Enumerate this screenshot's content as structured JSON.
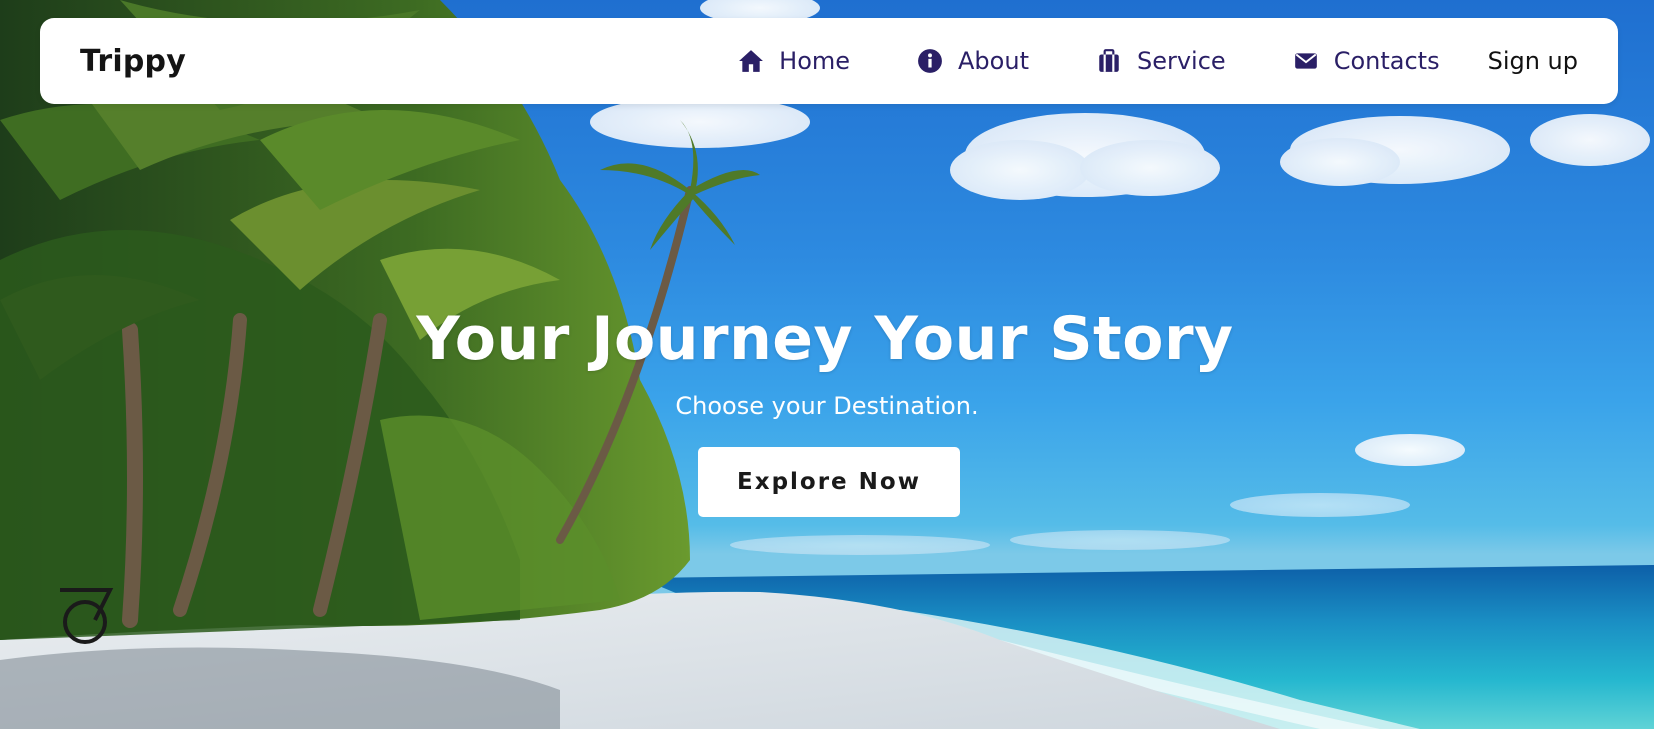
{
  "brand": {
    "name": "Trippy"
  },
  "nav": {
    "items": [
      {
        "label": "Home",
        "icon": "home-icon"
      },
      {
        "label": "About",
        "icon": "info-icon"
      },
      {
        "label": "Service",
        "icon": "suitcase-icon"
      },
      {
        "label": "Contacts",
        "icon": "envelope-icon"
      }
    ],
    "signup_label": "Sign up"
  },
  "hero": {
    "title": "Your Journey Your Story",
    "subtitle": "Choose your Destination.",
    "cta_label": "Explore Now",
    "background": "tropical-beach-palm-trees"
  },
  "colors": {
    "nav_text": "#2a1f66",
    "navbar_bg": "#ffffff",
    "hero_text": "#ffffff",
    "button_bg": "#ffffff"
  }
}
